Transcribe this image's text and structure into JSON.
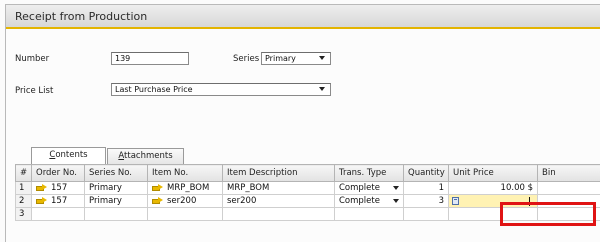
{
  "window": {
    "title": "Receipt from Production"
  },
  "header": {
    "number_label": "Number",
    "number_value": "139",
    "series_label": "Series",
    "series_value": "Primary",
    "price_list_label": "Price List",
    "price_list_value": "Last Purchase Price"
  },
  "tabs": [
    {
      "label": "Contents",
      "mnemonic": "C",
      "rest": "ontents",
      "active": true
    },
    {
      "label": "Attachments",
      "mnemonic": "A",
      "rest": "ttachments",
      "active": false
    }
  ],
  "grid": {
    "columns": [
      "#",
      "Order No.",
      "Series No.",
      "Item No.",
      "Item Description",
      "Trans. Type",
      "Quantity",
      "Unit Price",
      "Bin"
    ],
    "rows": [
      {
        "num": "1",
        "order_no": "157",
        "series_no": "Primary",
        "item_no": "MRP_BOM",
        "description": "MRP_BOM",
        "trans_type": "Complete",
        "quantity": "1",
        "unit_price": "10.00 $"
      },
      {
        "num": "2",
        "order_no": "157",
        "series_no": "Primary",
        "item_no": "ser200",
        "description": "ser200",
        "trans_type": "Complete",
        "quantity": "3",
        "unit_price": ""
      },
      {
        "num": "3",
        "order_no": "",
        "series_no": "",
        "item_no": "",
        "description": "",
        "trans_type": "",
        "quantity": "",
        "unit_price": ""
      }
    ]
  },
  "icons": {
    "link_arrow": "orange-link-arrow-icon",
    "dropdown": "chevron-down-icon",
    "calculator": "calculator-icon"
  },
  "colors": {
    "title_underline": "#e3b400",
    "link_arrow": "#e8b800",
    "active_cell": "#fff2b3",
    "highlight": "#e01414"
  }
}
